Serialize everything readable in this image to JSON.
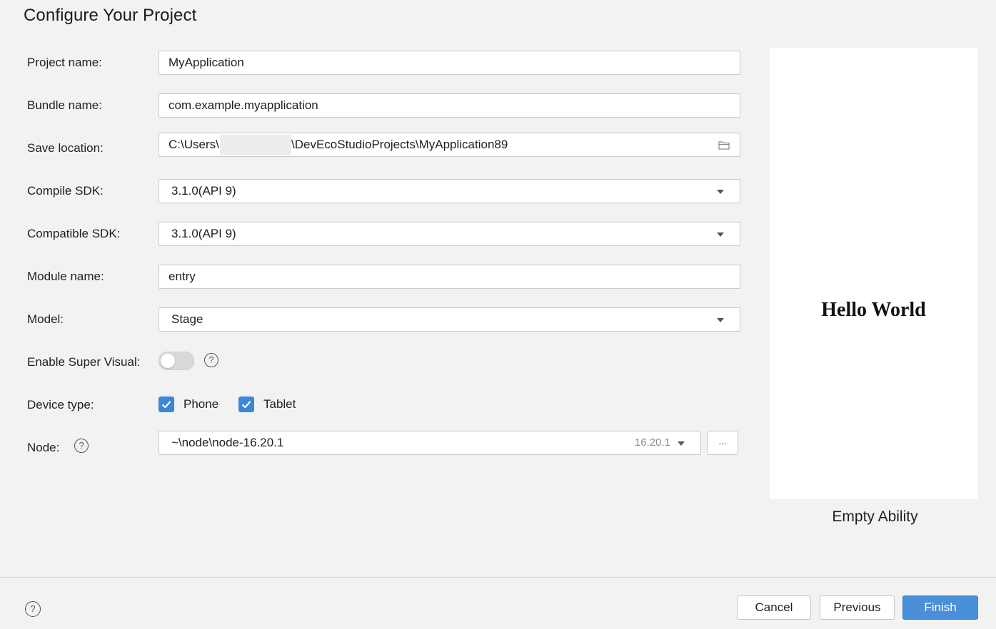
{
  "title": "Configure Your Project",
  "form": {
    "project_name": {
      "label": "Project name:",
      "value": "MyApplication"
    },
    "bundle_name": {
      "label": "Bundle name:",
      "value": "com.example.myapplication"
    },
    "save_location": {
      "label": "Save location:",
      "value_prefix": "C:\\Users\\",
      "value_suffix": "\\DevEcoStudioProjects\\MyApplication89",
      "icon": "folder-icon"
    },
    "compile_sdk": {
      "label": "Compile SDK:",
      "value": "3.1.0(API 9)"
    },
    "compatible_sdk": {
      "label": "Compatible SDK:",
      "value": "3.1.0(API 9)"
    },
    "module_name": {
      "label": "Module name:",
      "value": "entry"
    },
    "model": {
      "label": "Model:",
      "value": "Stage"
    },
    "super_visual": {
      "label": "Enable Super Visual:",
      "enabled": false,
      "help": "?"
    },
    "device_type": {
      "label": "Device type:",
      "options": [
        {
          "label": "Phone",
          "checked": true
        },
        {
          "label": "Tablet",
          "checked": true
        }
      ]
    },
    "node": {
      "label": "Node:",
      "help": "?",
      "value": "~\\node\\node-16.20.1",
      "version": "16.20.1",
      "browse_label": "..."
    }
  },
  "preview": {
    "screen_text": "Hello World",
    "caption": "Empty Ability"
  },
  "footer": {
    "help": "?",
    "cancel_label": "Cancel",
    "previous_label": "Previous",
    "finish_label": "Finish"
  },
  "colors": {
    "background": "#f2f2f2",
    "accent": "#4a8fd9",
    "checkbox": "#3a87d6"
  }
}
